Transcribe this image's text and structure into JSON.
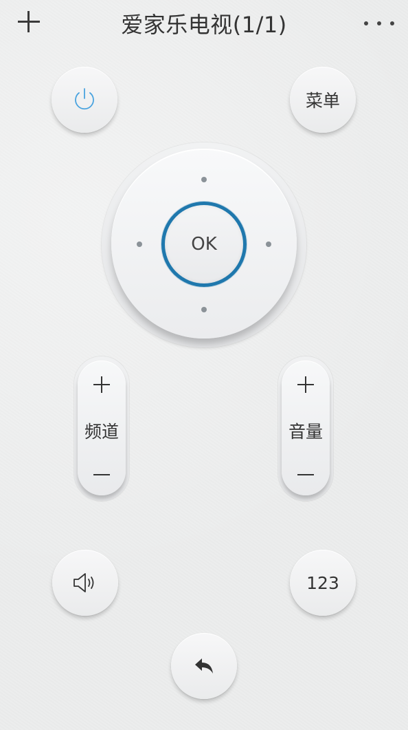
{
  "header": {
    "title": "爱家乐电视(1/1)",
    "add_icon": "plus-icon",
    "more_icon": "more-dots-icon"
  },
  "buttons": {
    "power_icon": "power-icon",
    "menu_label": "菜单",
    "ok_label": "OK",
    "mute_icon": "speaker-icon",
    "numpad_label": "123",
    "back_icon": "back-arrow-icon"
  },
  "channel": {
    "label": "频道",
    "plus": "+",
    "minus": "−"
  },
  "volume": {
    "label": "音量",
    "plus": "+",
    "minus": "−"
  },
  "colors": {
    "accent": "#1f78ad",
    "power_icon": "#4aa3df",
    "background": "#eceded"
  }
}
